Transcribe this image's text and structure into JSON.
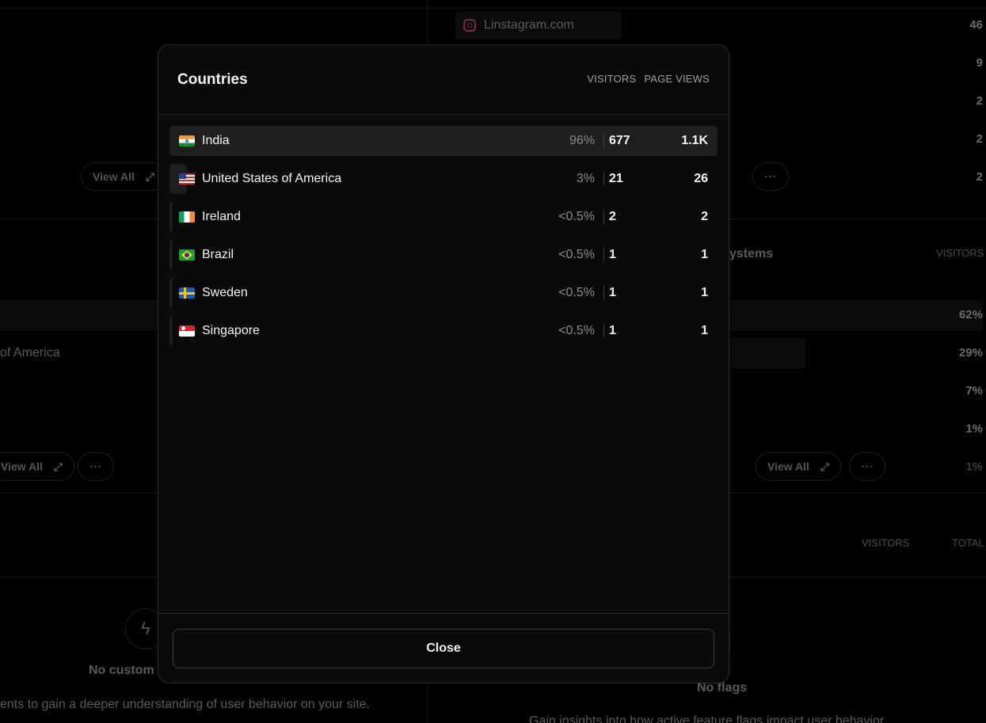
{
  "background": {
    "referrer": {
      "label": "Linstagram.com",
      "icon": "instagram-icon"
    },
    "right_numbers": [
      "46",
      "9",
      "2",
      "2",
      "2"
    ],
    "view_all_label": "View All",
    "partial_america": "of America",
    "systems_label": "ystems",
    "visitors_head": "VISITORS",
    "os_percents": [
      "62%",
      "29%",
      "7%",
      "1%",
      "1%"
    ],
    "events_visitors_head": "VISITORS",
    "events_total_head": "TOTAL",
    "no_custom_label": "No custom",
    "no_custom_desc": "ents to gain a deeper understanding of user behavior on your site.",
    "no_flags_label": "No flags",
    "flags_desc": "Gain insights into how active feature flags impact user behavior"
  },
  "modal": {
    "title": "Countries",
    "col_visitors": "VISITORS",
    "col_page_views": "PAGE VIEWS",
    "rows": [
      {
        "country": "India",
        "flag": "flag-india-icon",
        "percent": "96%",
        "visitors": "677",
        "page_views": "1.1K"
      },
      {
        "country": "United States of America",
        "flag": "flag-usa-icon",
        "percent": "3%",
        "visitors": "21",
        "page_views": "26"
      },
      {
        "country": "Ireland",
        "flag": "flag-ireland-icon",
        "percent": "<0.5%",
        "visitors": "2",
        "page_views": "2"
      },
      {
        "country": "Brazil",
        "flag": "flag-brazil-icon",
        "percent": "<0.5%",
        "visitors": "1",
        "page_views": "1"
      },
      {
        "country": "Sweden",
        "flag": "flag-sweden-icon",
        "percent": "<0.5%",
        "visitors": "1",
        "page_views": "1"
      },
      {
        "country": "Singapore",
        "flag": "flag-singapore-icon",
        "percent": "<0.5%",
        "visitors": "1",
        "page_views": "1"
      }
    ],
    "close_label": "Close"
  }
}
